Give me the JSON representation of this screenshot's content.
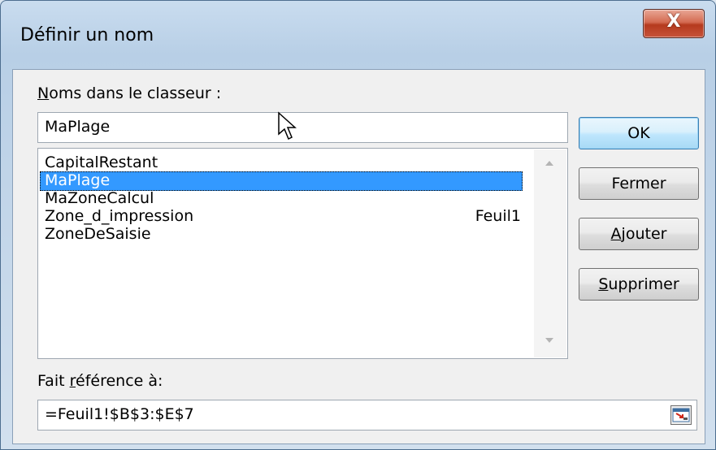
{
  "dialog": {
    "title": "Définir un nom",
    "close_glyph": "X"
  },
  "names": {
    "label_mnemonic": "N",
    "label_rest": "oms dans le classeur :",
    "input_value": "MaPlage",
    "items": [
      {
        "name": "CapitalRestant",
        "scope": ""
      },
      {
        "name": "MaPlage",
        "scope": "",
        "selected": true
      },
      {
        "name": "MaZoneCalcul",
        "scope": ""
      },
      {
        "name": "Zone_d_impression",
        "scope": "Feuil1"
      },
      {
        "name": "ZoneDeSaisie",
        "scope": ""
      }
    ]
  },
  "buttons": {
    "ok": "OK",
    "close": "Fermer",
    "add_mnemonic": "A",
    "add_rest": "jouter",
    "delete_mnemonic": "S",
    "delete_rest": "upprimer"
  },
  "reference": {
    "label_pre": "Fait ",
    "label_mnemonic": "r",
    "label_rest": "éférence à:",
    "value": "=Feuil1!$B$3:$E$7"
  },
  "icons": {
    "close": "close-icon",
    "collapse": "collapse-dialog-icon",
    "pointer": "mouse-pointer-icon"
  }
}
